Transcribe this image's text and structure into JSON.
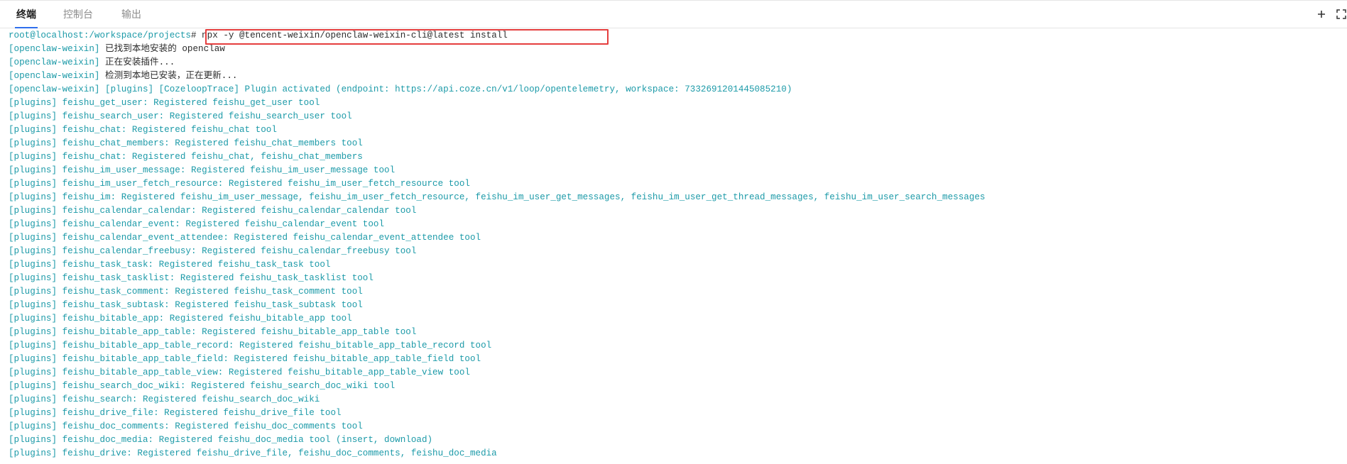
{
  "tabs": [
    "终端",
    "控制台",
    "输出"
  ],
  "active_tab": 0,
  "toolbar": {
    "add_icon": "plus-icon",
    "fullscreen_icon": "fullscreen-icon"
  },
  "colors": {
    "prompt": "#1c9aa8",
    "text": "#2c2c2c",
    "highlight_box": "#e53e3e",
    "tab_active": "#1f1f1f",
    "tab_inactive": "#8c8c8c"
  },
  "terminal": {
    "prompt": {
      "user_host": "root@localhost",
      "path": ":/workspace/projects",
      "command": "# npx -y @tencent-weixin/openclaw-weixin-cli@latest install"
    },
    "lines": [
      {
        "prefix": "[openclaw-weixin]",
        "text": " 已找到本地安装的 openclaw"
      },
      {
        "prefix": "[openclaw-weixin]",
        "text": " 正在安装插件..."
      },
      {
        "prefix": "[openclaw-weixin]",
        "text": " 检测到本地已安装，正在更新..."
      },
      {
        "prefix": "[openclaw-weixin]",
        "text": " [plugins] [CozeloopTrace] Plugin activated (endpoint: https://api.coze.cn/v1/loop/opentelemetry, workspace: 7332691201445085210)"
      },
      {
        "prefix": "[plugins]",
        "text": " feishu_get_user: Registered feishu_get_user tool"
      },
      {
        "prefix": "[plugins]",
        "text": " feishu_search_user: Registered feishu_search_user tool"
      },
      {
        "prefix": "[plugins]",
        "text": " feishu_chat: Registered feishu_chat tool"
      },
      {
        "prefix": "[plugins]",
        "text": " feishu_chat_members: Registered feishu_chat_members tool"
      },
      {
        "prefix": "[plugins]",
        "text": " feishu_chat: Registered feishu_chat, feishu_chat_members"
      },
      {
        "prefix": "[plugins]",
        "text": " feishu_im_user_message: Registered feishu_im_user_message tool"
      },
      {
        "prefix": "[plugins]",
        "text": " feishu_im_user_fetch_resource: Registered feishu_im_user_fetch_resource tool"
      },
      {
        "prefix": "[plugins]",
        "text": " feishu_im: Registered feishu_im_user_message, feishu_im_user_fetch_resource, feishu_im_user_get_messages, feishu_im_user_get_thread_messages, feishu_im_user_search_messages"
      },
      {
        "prefix": "[plugins]",
        "text": " feishu_calendar_calendar: Registered feishu_calendar_calendar tool"
      },
      {
        "prefix": "[plugins]",
        "text": " feishu_calendar_event: Registered feishu_calendar_event tool"
      },
      {
        "prefix": "[plugins]",
        "text": " feishu_calendar_event_attendee: Registered feishu_calendar_event_attendee tool"
      },
      {
        "prefix": "[plugins]",
        "text": " feishu_calendar_freebusy: Registered feishu_calendar_freebusy tool"
      },
      {
        "prefix": "[plugins]",
        "text": " feishu_task_task: Registered feishu_task_task tool"
      },
      {
        "prefix": "[plugins]",
        "text": " feishu_task_tasklist: Registered feishu_task_tasklist tool"
      },
      {
        "prefix": "[plugins]",
        "text": " feishu_task_comment: Registered feishu_task_comment tool"
      },
      {
        "prefix": "[plugins]",
        "text": " feishu_task_subtask: Registered feishu_task_subtask tool"
      },
      {
        "prefix": "[plugins]",
        "text": " feishu_bitable_app: Registered feishu_bitable_app tool"
      },
      {
        "prefix": "[plugins]",
        "text": " feishu_bitable_app_table: Registered feishu_bitable_app_table tool"
      },
      {
        "prefix": "[plugins]",
        "text": " feishu_bitable_app_table_record: Registered feishu_bitable_app_table_record tool"
      },
      {
        "prefix": "[plugins]",
        "text": " feishu_bitable_app_table_field: Registered feishu_bitable_app_table_field tool"
      },
      {
        "prefix": "[plugins]",
        "text": " feishu_bitable_app_table_view: Registered feishu_bitable_app_table_view tool"
      },
      {
        "prefix": "[plugins]",
        "text": " feishu_search_doc_wiki: Registered feishu_search_doc_wiki tool"
      },
      {
        "prefix": "[plugins]",
        "text": " feishu_search: Registered feishu_search_doc_wiki"
      },
      {
        "prefix": "[plugins]",
        "text": " feishu_drive_file: Registered feishu_drive_file tool"
      },
      {
        "prefix": "[plugins]",
        "text": " feishu_doc_comments: Registered feishu_doc_comments tool"
      },
      {
        "prefix": "[plugins]",
        "text": " feishu_doc_media: Registered feishu_doc_media tool (insert, download)"
      },
      {
        "prefix": "[plugins]",
        "text": " feishu_drive: Registered feishu_drive_file, feishu_doc_comments, feishu_doc_media"
      }
    ]
  }
}
